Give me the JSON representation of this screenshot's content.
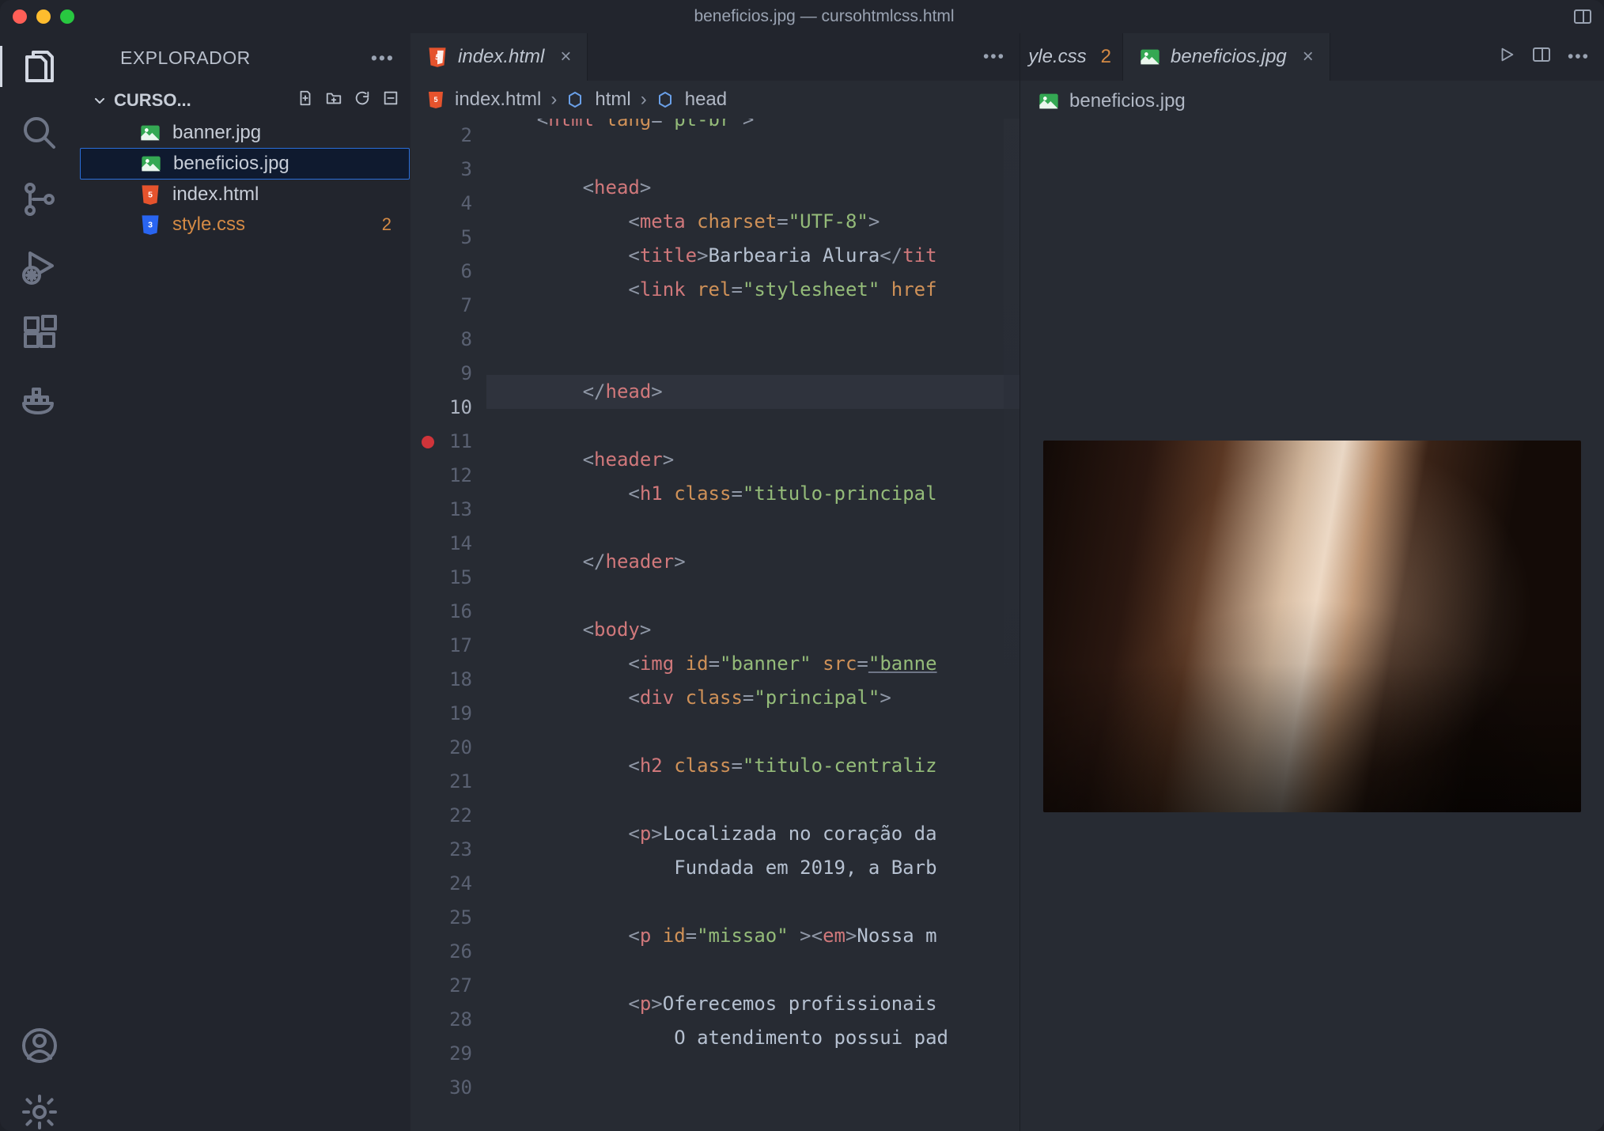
{
  "titlebar": {
    "title": "beneficios.jpg — cursohtmlcss.html"
  },
  "activitybar": {
    "items": [
      "files",
      "search",
      "scm",
      "debug",
      "extensions",
      "docker"
    ],
    "bottom": [
      "account",
      "settings"
    ]
  },
  "sidebar": {
    "title": "EXPLORADOR",
    "folder": "CURSO...",
    "files": [
      {
        "name": "banner.jpg",
        "icon": "img"
      },
      {
        "name": "beneficios.jpg",
        "icon": "img",
        "selected": true
      },
      {
        "name": "index.html",
        "icon": "html"
      },
      {
        "name": "style.css",
        "icon": "css",
        "problems": "2"
      }
    ]
  },
  "leftGroup": {
    "tabs": [
      {
        "label": "index.html",
        "icon": "html",
        "active": true,
        "close": "×"
      }
    ],
    "breadcrumb": {
      "file": "index.html",
      "node1": "html",
      "node2": "head"
    },
    "code": {
      "startLine": 2,
      "currentLine": 10,
      "breakpointLine": 11,
      "lines": [
        {
          "n": 2,
          "html": "<span class='tk-delim'>&lt;</span><span class='tk-tag'>html</span> <span class='tk-attr'>lang</span><span class='tk-delim'>=</span><span class='tk-str'>\"pt-br\"</span><span class='tk-delim'>&gt;</span>",
          "indent": 1,
          "partial": true
        },
        {
          "n": 3,
          "html": "",
          "indent": 1
        },
        {
          "n": 4,
          "html": "<span class='tk-delim'>&lt;</span><span class='tk-tag'>head</span><span class='tk-delim'>&gt;</span>",
          "indent": 2
        },
        {
          "n": 5,
          "html": "<span class='tk-delim'>&lt;</span><span class='tk-tag'>meta</span> <span class='tk-attr'>charset</span><span class='tk-delim'>=</span><span class='tk-str'>\"UTF-8\"</span><span class='tk-delim'>&gt;</span>",
          "indent": 3
        },
        {
          "n": 6,
          "html": "<span class='tk-delim'>&lt;</span><span class='tk-tag'>title</span><span class='tk-delim'>&gt;</span><span class='tk-text'>Barbearia Alura</span><span class='tk-delim'>&lt;/</span><span class='tk-tag'>tit</span>",
          "indent": 3
        },
        {
          "n": 7,
          "html": "<span class='tk-delim'>&lt;</span><span class='tk-tag'>link</span> <span class='tk-attr'>rel</span><span class='tk-delim'>=</span><span class='tk-str'>\"stylesheet\"</span> <span class='tk-attr'>href</span>",
          "indent": 3
        },
        {
          "n": 8,
          "html": "",
          "indent": 3
        },
        {
          "n": 9,
          "html": "",
          "indent": 2
        },
        {
          "n": 10,
          "html": "<span class='tk-delim'>&lt;/</span><span class='tk-tag'>head</span><span class='tk-delim'>&gt;</span>",
          "indent": 2,
          "hl": true
        },
        {
          "n": 11,
          "html": "",
          "indent": 1
        },
        {
          "n": 12,
          "html": "<span class='tk-delim'>&lt;</span><span class='tk-tag'>header</span><span class='tk-delim'>&gt;</span>",
          "indent": 2
        },
        {
          "n": 13,
          "html": "<span class='tk-delim'>&lt;</span><span class='tk-tag'>h1</span> <span class='tk-attr'>class</span><span class='tk-delim'>=</span><span class='tk-str'>\"titulo-principal</span>",
          "indent": 3
        },
        {
          "n": 14,
          "html": "",
          "indent": 2
        },
        {
          "n": 15,
          "html": "<span class='tk-delim'>&lt;/</span><span class='tk-tag'>header</span><span class='tk-delim'>&gt;</span>",
          "indent": 2
        },
        {
          "n": 16,
          "html": "",
          "indent": 1
        },
        {
          "n": 17,
          "html": "<span class='tk-delim'>&lt;</span><span class='tk-tag'>body</span><span class='tk-delim'>&gt;</span>",
          "indent": 2
        },
        {
          "n": 18,
          "html": "<span class='tk-delim'>&lt;</span><span class='tk-tag'>img</span> <span class='tk-attr'>id</span><span class='tk-delim'>=</span><span class='tk-str'>\"banner\"</span> <span class='tk-attr'>src</span><span class='tk-delim'>=</span><span class='tk-str underline'>\"banne</span>",
          "indent": 3
        },
        {
          "n": 19,
          "html": "<span class='tk-delim'>&lt;</span><span class='tk-tag'>div</span> <span class='tk-attr'>class</span><span class='tk-delim'>=</span><span class='tk-str'>\"principal\"</span><span class='tk-delim'>&gt;</span>",
          "indent": 3
        },
        {
          "n": 20,
          "html": "",
          "indent": 3
        },
        {
          "n": 21,
          "html": "<span class='tk-delim'>&lt;</span><span class='tk-tag'>h2</span> <span class='tk-attr'>class</span><span class='tk-delim'>=</span><span class='tk-str'>\"titulo-centraliz</span>",
          "indent": 3
        },
        {
          "n": 22,
          "html": "",
          "indent": 3
        },
        {
          "n": 23,
          "html": "<span class='tk-delim'>&lt;</span><span class='tk-tag'>p</span><span class='tk-delim'>&gt;</span><span class='tk-text'>Localizada no coração da</span>",
          "indent": 3
        },
        {
          "n": 24,
          "html": "<span class='tk-text'>Fundada em 2019, a Barb</span>",
          "indent": 4
        },
        {
          "n": 25,
          "html": "",
          "indent": 3
        },
        {
          "n": 26,
          "html": "<span class='tk-delim'>&lt;</span><span class='tk-tag'>p</span> <span class='tk-attr'>id</span><span class='tk-delim'>=</span><span class='tk-str'>\"missao\"</span> <span class='tk-delim'>&gt;&lt;</span><span class='tk-tag'>em</span><span class='tk-delim'>&gt;</span><span class='tk-text'>Nossa m</span>",
          "indent": 3
        },
        {
          "n": 27,
          "html": "",
          "indent": 3
        },
        {
          "n": 28,
          "html": "<span class='tk-delim'>&lt;</span><span class='tk-tag'>p</span><span class='tk-delim'>&gt;</span><span class='tk-text'>Oferecemos profissionais</span>",
          "indent": 3
        },
        {
          "n": 29,
          "html": "<span class='tk-text'>O atendimento possui pad</span>",
          "indent": 4
        },
        {
          "n": 30,
          "html": "",
          "indent": 3
        }
      ]
    }
  },
  "rightGroup": {
    "tabs": [
      {
        "label": "yle.css",
        "icon": "peek",
        "mod": "2"
      },
      {
        "label": "beneficios.jpg",
        "icon": "img",
        "active": true,
        "close": "×"
      }
    ],
    "breadcrumb": {
      "file": "beneficios.jpg"
    }
  }
}
